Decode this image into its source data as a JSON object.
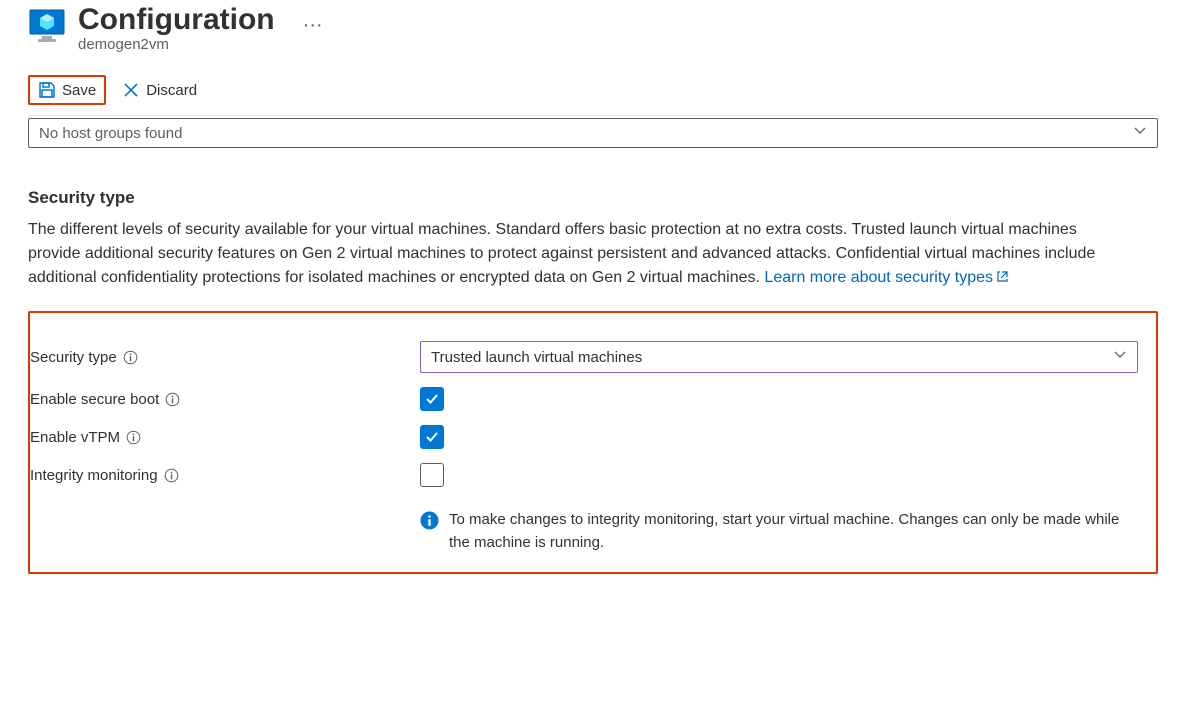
{
  "header": {
    "title": "Configuration",
    "subtitle": "demogen2vm"
  },
  "toolbar": {
    "save_label": "Save",
    "discard_label": "Discard"
  },
  "host_group": {
    "placeholder": "No host groups found"
  },
  "security": {
    "heading": "Security type",
    "description": "The different levels of security available for your virtual machines. Standard offers basic protection at no extra costs. Trusted launch virtual machines provide additional security features on Gen 2 virtual machines to protect against persistent and advanced attacks. Confidential virtual machines include additional confidentiality protections for isolated machines or encrypted data on Gen 2 virtual machines. ",
    "learn_more": "Learn more about security types"
  },
  "form": {
    "security_type_label": "Security type",
    "security_type_value": "Trusted launch virtual machines",
    "enable_secure_boot_label": "Enable secure boot",
    "enable_secure_boot_checked": true,
    "enable_vtpm_label": "Enable vTPM",
    "enable_vtpm_checked": true,
    "integrity_monitoring_label": "Integrity monitoring",
    "integrity_monitoring_checked": false,
    "integrity_note": "To make changes to integrity monitoring, start your virtual machine. Changes can only be made while the machine is running."
  },
  "icons": {
    "vm": "vm-icon",
    "save": "save-icon",
    "discard": "close-icon",
    "chevron": "chevron-down-icon",
    "info": "info-icon",
    "external": "external-link-icon",
    "info_fill": "info-filled-icon"
  }
}
